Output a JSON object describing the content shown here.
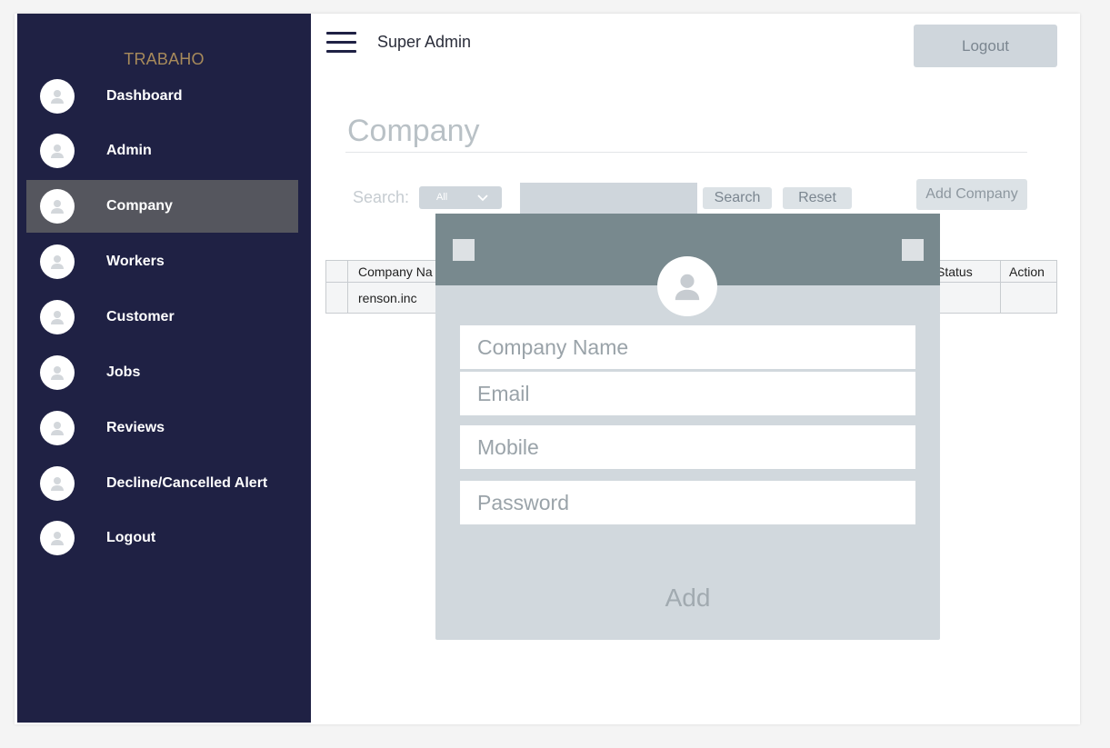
{
  "brand": "TRABAHO",
  "header": {
    "user_label": "Super Admin",
    "logout_label": "Logout"
  },
  "sidebar": {
    "items": [
      {
        "label": "Dashboard",
        "active": false
      },
      {
        "label": "Admin",
        "active": false
      },
      {
        "label": "Company",
        "active": true
      },
      {
        "label": "Workers",
        "active": false
      },
      {
        "label": "Customer",
        "active": false
      },
      {
        "label": "Jobs",
        "active": false
      },
      {
        "label": "Reviews",
        "active": false
      },
      {
        "label": "Decline/Cancelled Alert",
        "active": false
      },
      {
        "label": "Logout",
        "active": false
      }
    ]
  },
  "main": {
    "title": "Company",
    "search": {
      "label": "Search:",
      "filter_value": "All",
      "input_value": "",
      "search_label": "Search",
      "reset_label": "Reset",
      "add_label": "Add Company"
    },
    "table": {
      "headers": [
        "",
        "Company Na",
        "Status",
        "Action"
      ],
      "rows": [
        [
          "",
          "renson.inc",
          "",
          ""
        ]
      ]
    }
  },
  "modal": {
    "fields": [
      {
        "placeholder": "Company Name"
      },
      {
        "placeholder": "Email"
      },
      {
        "placeholder": "Mobile"
      },
      {
        "placeholder": "Password"
      }
    ],
    "submit_label": "Add"
  },
  "colors": {
    "sidebar_bg": "#1f2144",
    "sidebar_active": "#55565e",
    "brand": "#a78a5b",
    "modal_header": "#78898e",
    "modal_body": "#d1d8dd"
  },
  "icons": {
    "nav": "user-avatar-icon",
    "menu": "hamburger-menu-icon",
    "dropdown": "chevron-down-icon"
  }
}
